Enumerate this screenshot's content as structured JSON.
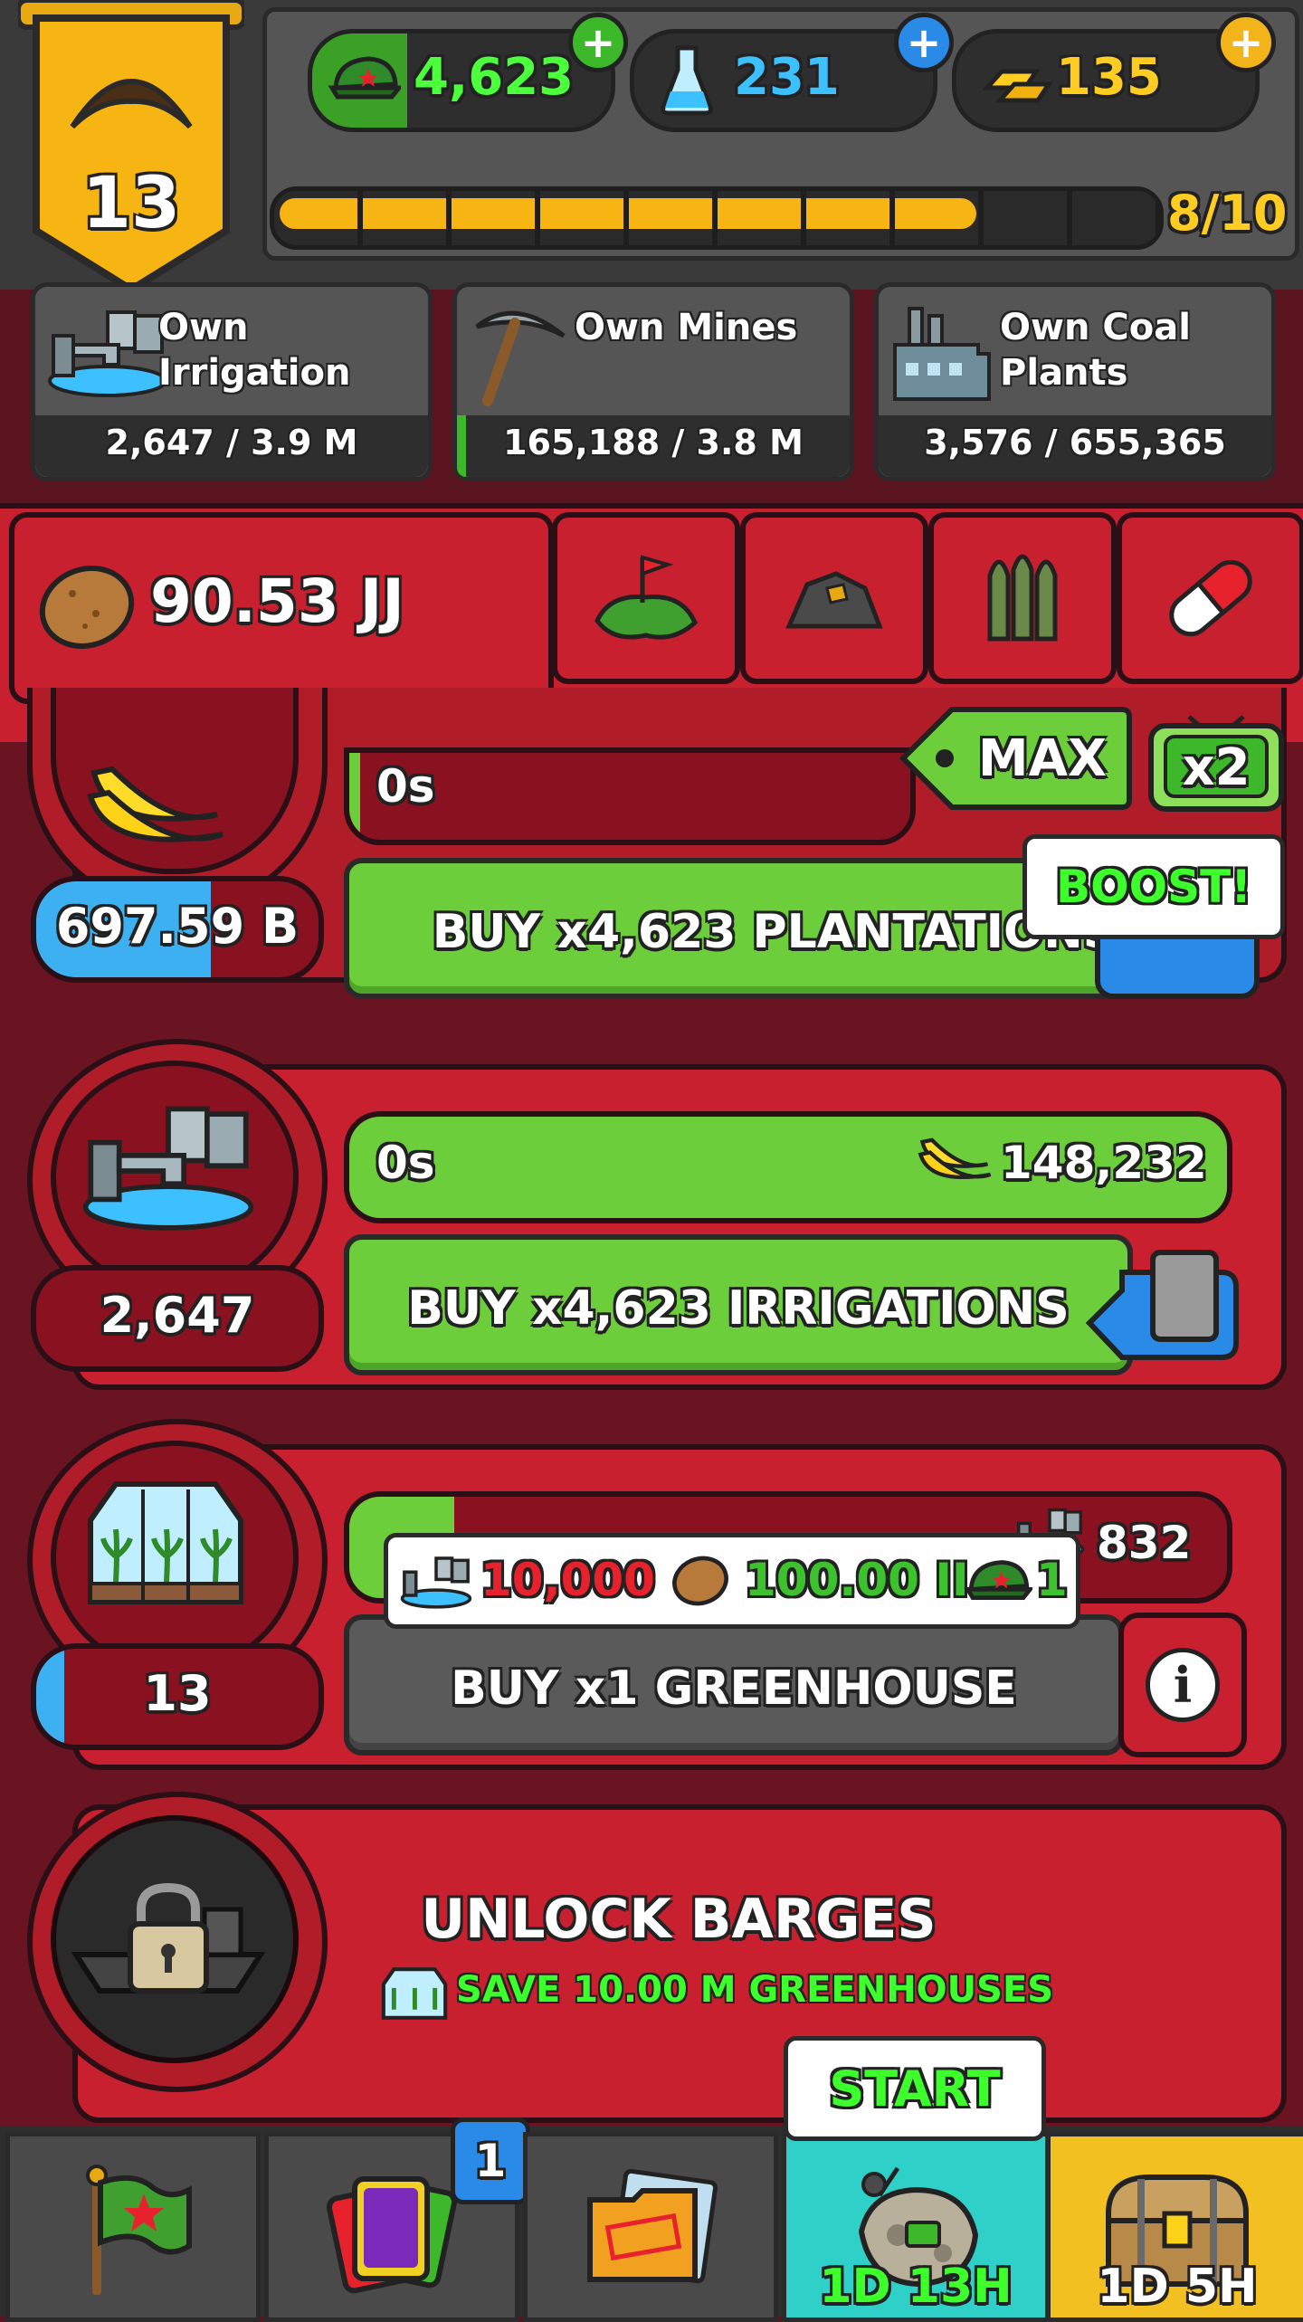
{
  "header": {
    "level": "13",
    "currencies": [
      {
        "name": "medals",
        "value": "4,623",
        "icon": "army-cap-icon",
        "color": "#4cff3c"
      },
      {
        "name": "science",
        "value": "231",
        "icon": "flask-icon",
        "color": "#3cc0ff"
      },
      {
        "name": "gold",
        "value": "135",
        "icon": "gold-bars-icon",
        "color": "#ffcc22"
      }
    ],
    "xp_progress": "8/10",
    "xp_fraction": 0.8
  },
  "own_cards": [
    {
      "title": "Own Irrigation",
      "value": "2,647 / 3.9 M",
      "icon": "irrigation-icon"
    },
    {
      "title": "Own Mines",
      "value": "165,188 / 3.8 M",
      "icon": "pickaxe-icon"
    },
    {
      "title": "Own Coal Plants",
      "value": "3,576 / 655,365",
      "icon": "coal-plant-icon"
    }
  ],
  "resource": {
    "value": "90.53 JJ",
    "icon": "potato-icon"
  },
  "tabs": [
    {
      "icon": "island-flag-icon"
    },
    {
      "icon": "ore-rock-icon"
    },
    {
      "icon": "ammo-icon"
    },
    {
      "icon": "pill-icon"
    }
  ],
  "controls": {
    "max_label": "MAX",
    "multiplier_label": "x2",
    "boost_label": "BOOST!"
  },
  "rows": [
    {
      "name": "plantations",
      "timer": "0s",
      "count": "697.59 B",
      "buy_label": "BUY x4,623 PLANTATIONS",
      "icon": "bananas-icon"
    },
    {
      "name": "irrigations",
      "timer": "0s",
      "produce_value": "148,232",
      "produce_icon": "bananas-icon",
      "count": "2,647",
      "buy_label": "BUY x4,623 IRRIGATIONS",
      "icon": "irrigation-icon"
    },
    {
      "name": "greenhouse",
      "produce_value": "832",
      "count": "13",
      "buy_label": "BUY x1 GREENHOUSE",
      "icon": "greenhouse-icon",
      "info_label": "i",
      "cost": [
        {
          "icon": "irrigation-icon",
          "value": "10,000",
          "color": "#e8222c"
        },
        {
          "icon": "potato-icon",
          "value": "100.00 II",
          "color": "#3cc22c"
        },
        {
          "icon": "army-cap-icon",
          "value": "1",
          "color": "#3cc22c"
        }
      ]
    }
  ],
  "unlock": {
    "title": "UNLOCK BARGES",
    "subtitle": "SAVE 10.00 M GREENHOUSES",
    "icon": "locked-barge-icon"
  },
  "bottom_nav": [
    {
      "icon": "flag-icon"
    },
    {
      "icon": "cards-icon",
      "badge": "1"
    },
    {
      "icon": "secret-folder-icon"
    },
    {
      "icon": "meteor-event-icon",
      "label": "1D 13H",
      "tooltip": "START"
    },
    {
      "icon": "treasure-chest-icon",
      "label": "1D 5H"
    }
  ]
}
